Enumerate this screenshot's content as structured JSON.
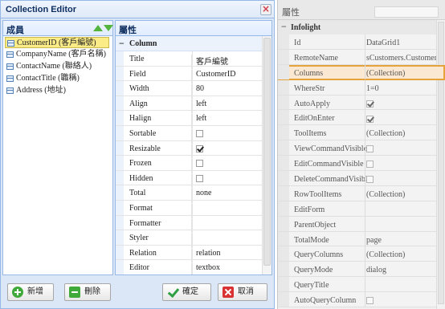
{
  "dialog": {
    "title": "Collection Editor",
    "members_label": "成員",
    "members": [
      {
        "label": "CustomerID (客戶編號)",
        "selected": true
      },
      {
        "label": "CompanyName (客戶名稱)",
        "selected": false
      },
      {
        "label": "ContactName (聯絡人)",
        "selected": false
      },
      {
        "label": "ContactTitle (職稱)",
        "selected": false
      },
      {
        "label": "Address (地址)",
        "selected": false
      }
    ],
    "props_label": "屬性",
    "props_group": "Column",
    "props": [
      {
        "name": "Title",
        "value": "客戶編號"
      },
      {
        "name": "Field",
        "value": "CustomerID"
      },
      {
        "name": "Width",
        "value": "80"
      },
      {
        "name": "Align",
        "value": "left"
      },
      {
        "name": "Halign",
        "value": "left"
      },
      {
        "name": "Sortable",
        "check": false
      },
      {
        "name": "Resizable",
        "check": true
      },
      {
        "name": "Frozen",
        "check": false
      },
      {
        "name": "Hidden",
        "check": false
      },
      {
        "name": "Total",
        "value": "none"
      },
      {
        "name": "Format",
        "value": ""
      },
      {
        "name": "Formatter",
        "value": ""
      },
      {
        "name": "Styler",
        "value": ""
      },
      {
        "name": "Relation",
        "value": "relation"
      },
      {
        "name": "Editor",
        "value": "textbox"
      }
    ],
    "buttons": {
      "add": "新增",
      "delete": "刪除",
      "ok": "確定",
      "cancel": "取消"
    }
  },
  "side_panel": {
    "title": "屬性",
    "group": "Infolight",
    "rows": [
      {
        "name": "Id",
        "value": "DataGrid1"
      },
      {
        "name": "RemoteName",
        "value": "sCustomers.Customers"
      },
      {
        "name": "Columns",
        "value": "(Collection)",
        "highlight": true
      },
      {
        "name": "WhereStr",
        "value": "1=0"
      },
      {
        "name": "AutoApply",
        "check": true
      },
      {
        "name": "EditOnEnter",
        "check": true
      },
      {
        "name": "ToolItems",
        "value": "(Collection)"
      },
      {
        "name": "ViewCommandVisible",
        "check": false
      },
      {
        "name": "EditCommandVisible",
        "check": false
      },
      {
        "name": "DeleteCommandVisible",
        "check": false
      },
      {
        "name": "RowToolItems",
        "value": "(Collection)"
      },
      {
        "name": "EditForm",
        "value": ""
      },
      {
        "name": "ParentObject",
        "value": ""
      },
      {
        "name": "TotalMode",
        "value": "page"
      },
      {
        "name": "QueryColumns",
        "value": "(Collection)"
      },
      {
        "name": "QueryMode",
        "value": "dialog"
      },
      {
        "name": "QueryTitle",
        "value": ""
      },
      {
        "name": "AutoQueryColumn",
        "check": false
      }
    ]
  },
  "colors": {
    "highlight_border": "#e7a33b",
    "selected_member": "#fbec88",
    "dialog_border": "#95b8e7"
  }
}
